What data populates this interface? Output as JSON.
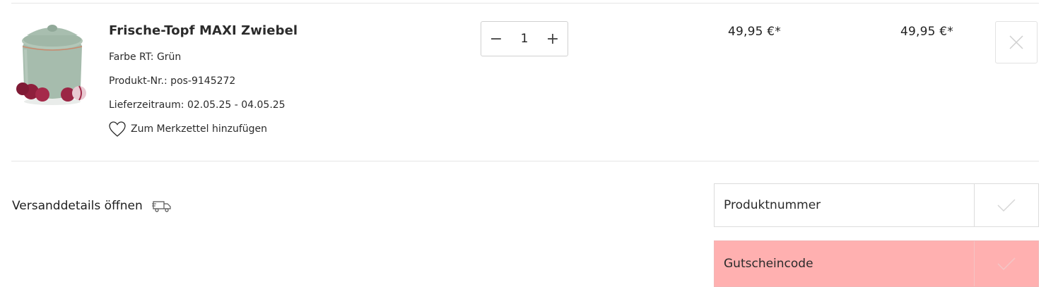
{
  "cart_item": {
    "image_alt": "Frische-Topf MAXI Zwiebel",
    "title": "Frische-Topf MAXI Zwiebel",
    "color_line": "Farbe RT: Grün",
    "sku_line": "Produkt-Nr.: pos-9145272",
    "delivery_line": "Lieferzeitraum: 02.05.25 - 04.05.25",
    "wishlist_label": "Zum Merkzettel hinzufügen",
    "quantity": "1",
    "qty_minus": "−",
    "qty_plus": "+",
    "unit_price": "49,95 €*",
    "total_price": "49,95 €*"
  },
  "shipping": {
    "label": "Versanddetails öffnen"
  },
  "forms": {
    "product_number_placeholder": "Produktnummer",
    "voucher_placeholder": "Gutscheincode"
  },
  "colors": {
    "voucher_highlight": "#ffb0b0",
    "pot_green": "#9bb3a4",
    "pot_rim": "#c98a6e"
  }
}
